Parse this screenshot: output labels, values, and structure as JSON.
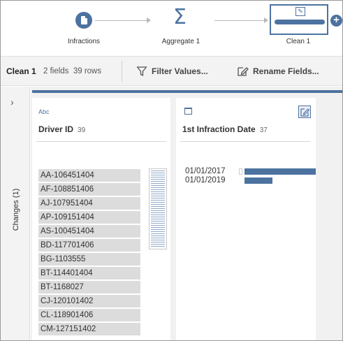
{
  "flow": {
    "nodes": [
      {
        "label": "Infractions",
        "icon": "document-icon"
      },
      {
        "label": "Aggregate 1",
        "icon": "sigma-icon"
      },
      {
        "label": "Clean 1",
        "icon": "clean-icon"
      }
    ],
    "add_symbol": "+"
  },
  "toolbar": {
    "step_name": "Clean 1",
    "counts": "2 fields  39 rows",
    "filter_label": "Filter Values...",
    "rename_label": "Rename Fields..."
  },
  "rail": {
    "chevron": "›",
    "changes_label": "Changes (1)"
  },
  "fields": [
    {
      "type_label": "Abc",
      "name": "Driver ID",
      "count": "39",
      "values": [
        "AA-106451404",
        "AF-108851406",
        "AJ-107951404",
        "AP-109151404",
        "AS-100451404",
        "BD-117701406",
        "BG-1103555",
        "BT-114401404",
        "BT-1168027",
        "CJ-120101402",
        "CL-118901406",
        "CM-127151402"
      ]
    },
    {
      "type_icon": "calendar-icon",
      "name": "1st Infraction Date",
      "count": "37",
      "values": [
        {
          "label": "01/01/2017",
          "fraction": 1.0
        },
        {
          "label": "01/01/2019",
          "fraction": 0.39
        }
      ]
    }
  ],
  "colors": {
    "accent": "#4c72a0",
    "value_bg": "#dcdcdc",
    "panel_bg": "#f1f1f1"
  }
}
